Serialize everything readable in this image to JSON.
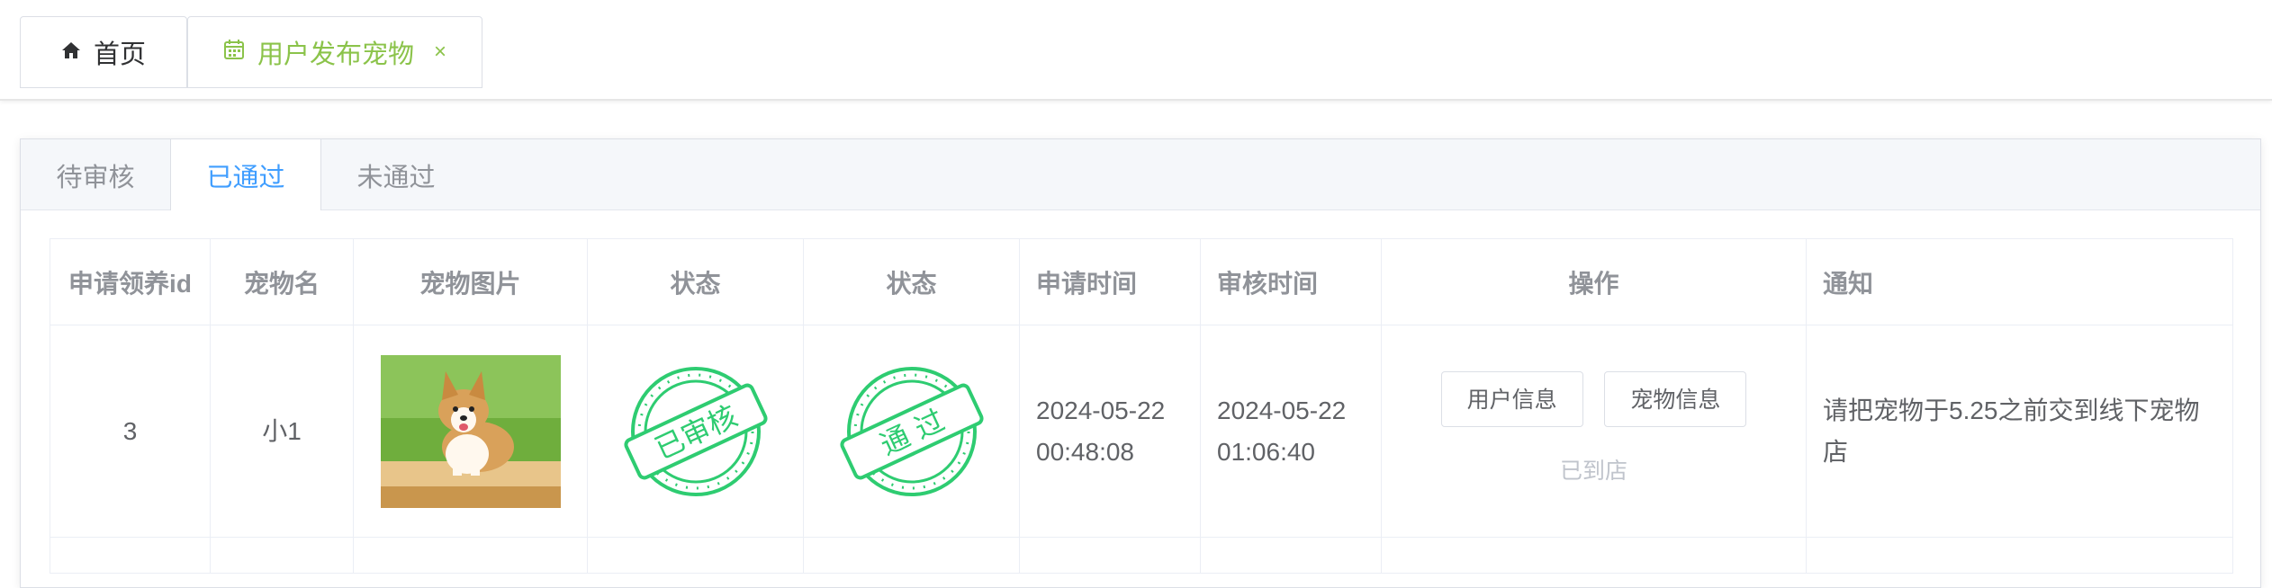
{
  "page_tabs": [
    {
      "label": "首页",
      "icon": "home-icon"
    },
    {
      "label": "用户发布宠物",
      "icon": "calendar-icon",
      "close": "×"
    }
  ],
  "review_tabs": [
    "待审核",
    "已通过",
    "未通过"
  ],
  "active_review_tab": "已通过",
  "table": {
    "headers": [
      "申请领养id",
      "宠物名",
      "宠物图片",
      "状态",
      "状态",
      "申请时间",
      "审核时间",
      "操作",
      "通知"
    ],
    "rows": [
      {
        "id": "3",
        "pet_name": "小1",
        "stamp1": "已审核",
        "stamp2": "通 过",
        "apply_date": "2024-05-22",
        "apply_time": "00:48:08",
        "review_date": "2024-05-22",
        "review_time": "01:06:40",
        "btn_user": "用户信息",
        "btn_pet": "宠物信息",
        "status_text": "已到店",
        "notice": "请把宠物于5.25之前交到线下宠物店"
      }
    ]
  },
  "colors": {
    "accent": "#409eff",
    "tab_green": "#8bc34a",
    "stamp_green": "#2ecc71"
  }
}
